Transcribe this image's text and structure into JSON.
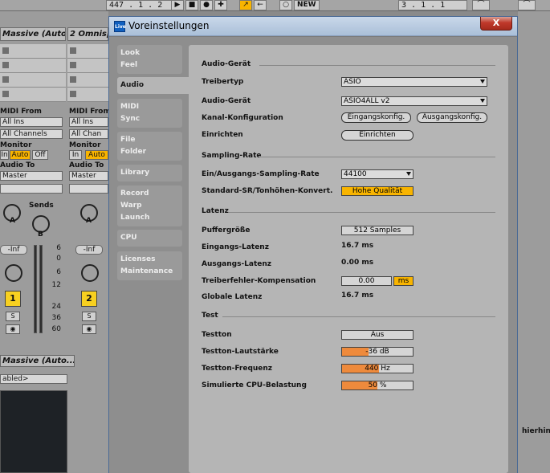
{
  "topbar": {
    "position": "447 .  1 .  2",
    "new_label": "NEW",
    "bar_right": "3 .  1 .  1",
    "play_icon": "play-icon",
    "stop_icon": "stop-icon",
    "record_icon": "record-icon",
    "add_icon": "add-icon"
  },
  "tracks": [
    {
      "name": "Massive (Auto",
      "midi_from_label": "MIDI From",
      "midi_from_value": "All Ins",
      "channel_value": "All Channels",
      "monitor_label": "Monitor",
      "monitor_in": "In",
      "monitor_auto": "Auto",
      "monitor_off": "Off",
      "audio_to_label": "Audio To",
      "audio_to_value": "Master",
      "sends_label": "Sends",
      "send_a": "A",
      "send_b": "B",
      "volume": "-Inf",
      "number": "1",
      "solo": "S"
    },
    {
      "name": "2 Omnisp",
      "midi_from_label": "MIDI From",
      "midi_from_value": "All Ins",
      "channel_value": "All Chan",
      "monitor_label": "Monitor",
      "monitor_in": "In",
      "monitor_auto": "Auto",
      "audio_to_label": "Audio To",
      "audio_to_value": "Master",
      "send_a": "A",
      "volume": "-Inf",
      "number": "2",
      "solo": "S"
    }
  ],
  "db_scale": [
    "6",
    "0",
    "6",
    "12",
    "24",
    "36",
    "60"
  ],
  "device": {
    "name": "Massive (Auto...",
    "select_value": "abled>"
  },
  "right_text": "hierhin",
  "dialog": {
    "title": "Voreinstellungen",
    "app_icon_label": "Live",
    "close_label": "X",
    "nav": [
      {
        "line1": "Look",
        "line2": "Feel"
      },
      {
        "line1": "Audio"
      },
      {
        "line1": "MIDI",
        "line2": "Sync"
      },
      {
        "line1": "File",
        "line2": "Folder"
      },
      {
        "line1": "Library"
      },
      {
        "line1": "Record",
        "line2": "Warp",
        "line3": "Launch"
      },
      {
        "line1": "CPU"
      },
      {
        "line1": "Licenses",
        "line2": "Maintenance"
      }
    ],
    "audio_device_section": "Audio-Gerät",
    "driver_type_label": "Treibertyp",
    "driver_type_value": "ASIO",
    "audio_device_label": "Audio-Gerät",
    "audio_device_value": "ASIO4ALL v2",
    "channel_config_label": "Kanal-Konfiguration",
    "input_config_btn": "Eingangskonfig.",
    "output_config_btn": "Ausgangskonfig.",
    "setup_label": "Einrichten",
    "setup_btn": "Einrichten",
    "sampling_section": "Sampling-Rate",
    "sample_rate_label": "Ein/Ausgangs-Sampling-Rate",
    "sample_rate_value": "44100",
    "src_label": "Standard-SR/Tonhöhen-Konvert.",
    "src_value": "Hohe Qualität",
    "latency_section": "Latenz",
    "buffer_label": "Puffergröße",
    "buffer_value": "512 Samples",
    "input_latency_label": "Eingangs-Latenz",
    "input_latency_value": "16.7 ms",
    "output_latency_label": "Ausgangs-Latenz",
    "output_latency_value": "0.00 ms",
    "driver_comp_label": "Treiberfehler-Kompensation",
    "driver_comp_value": "0.00",
    "driver_comp_unit": "ms",
    "overall_latency_label": "Globale Latenz",
    "overall_latency_value": "16.7 ms",
    "test_section": "Test",
    "test_tone_label": "Testton",
    "test_tone_value": "Aus",
    "test_volume_label": "Testton-Lautstärke",
    "test_volume_value": "-36 dB",
    "test_volume_fill": 0.38,
    "test_freq_label": "Testton-Frequenz",
    "test_freq_value": "440 Hz",
    "test_freq_fill": 0.52,
    "cpu_sim_label": "Simulierte CPU-Belastung",
    "cpu_sim_value": "50 %",
    "cpu_sim_fill": 0.5,
    "colors": {
      "accent_yellow": "#f8b400",
      "slider_orange": "#ee8a3c",
      "panel_gray": "#b5b5b5"
    }
  }
}
